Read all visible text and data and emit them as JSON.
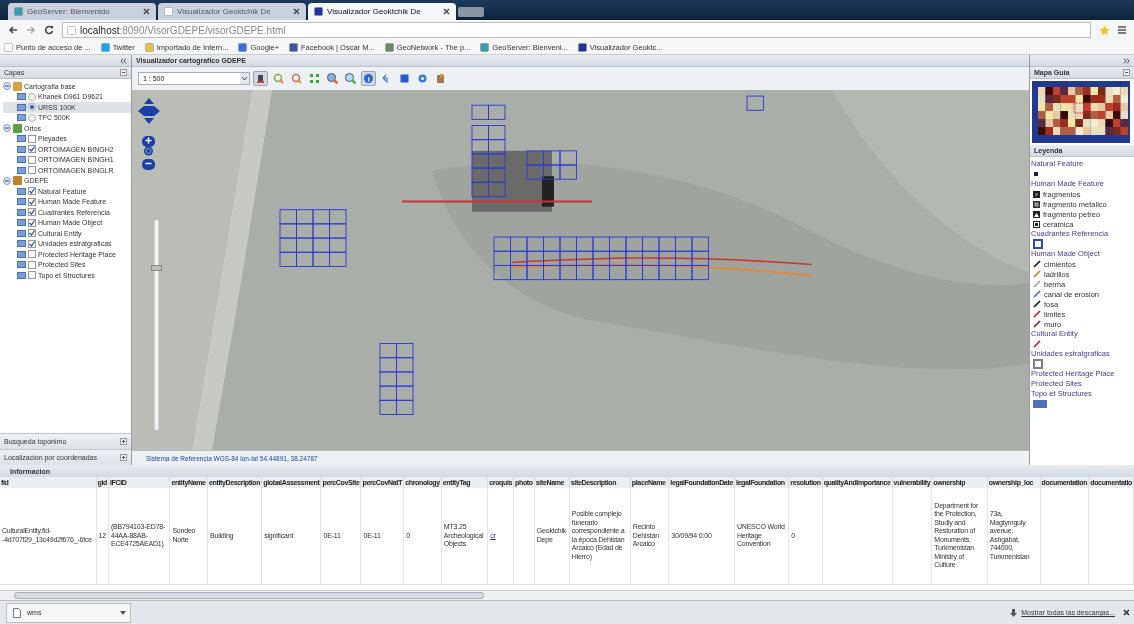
{
  "browser": {
    "tabs": [
      {
        "title": "GeoServer: Bienvenido",
        "kind": "geoserver",
        "selected": false
      },
      {
        "title": "Visualizador Geoktchik De",
        "kind": "page",
        "selected": false
      },
      {
        "title": "Visualizador Geoktchik De",
        "kind": "gdepe",
        "selected": true
      }
    ],
    "url": {
      "host": "localhost",
      "path": ":8090/VisorGDEPE/visorGDEPE.html"
    },
    "bookmarks": [
      {
        "label": "Punto de acceso de ...",
        "kind": "page"
      },
      {
        "label": "Twitter",
        "kind": "twitter"
      },
      {
        "label": "Importado de Intern...",
        "kind": "folder"
      },
      {
        "label": "Google+",
        "kind": "google"
      },
      {
        "label": "Facebook | Oscar M...",
        "kind": "facebook"
      },
      {
        "label": "GeoNetwork - The p...",
        "kind": "geonetwork"
      },
      {
        "label": "GeoServer: Bienveni...",
        "kind": "geoserver"
      },
      {
        "label": "Visualizador Geoktc...",
        "kind": "gdepe"
      }
    ]
  },
  "layers": {
    "title": "Capas",
    "tree": [
      {
        "label": "Cartografia base",
        "kind": "base",
        "expanded": true,
        "children": [
          {
            "label": "Khanek D961 D9621",
            "kind": "radio",
            "selected": false
          },
          {
            "label": "URSS 100K",
            "kind": "radio",
            "selected": true
          },
          {
            "label": "TPC 500K",
            "kind": "radio",
            "selected": false
          }
        ]
      },
      {
        "label": "Ortos",
        "kind": "imagery",
        "expanded": true,
        "children": [
          {
            "label": "Pleyades",
            "kind": "checkbox",
            "checked": false
          },
          {
            "label": "ORTOIMAGEN BINGH2",
            "kind": "checkbox",
            "checked": true
          },
          {
            "label": "ORTOIMAGEN BINGH1",
            "kind": "checkbox",
            "checked": false
          },
          {
            "label": "ORTOIMAGEN BINGLR",
            "kind": "checkbox",
            "checked": false
          }
        ]
      },
      {
        "label": "GDEPE",
        "kind": "data",
        "expanded": true,
        "children": [
          {
            "label": "Natural Feature",
            "kind": "checkbox",
            "checked": true
          },
          {
            "label": "Human Made Feature",
            "kind": "checkbox",
            "checked": true
          },
          {
            "label": "Cuadrantes Referencia",
            "kind": "checkbox",
            "checked": true
          },
          {
            "label": "Human Made Object",
            "kind": "checkbox",
            "checked": true
          },
          {
            "label": "Cultural Entity",
            "kind": "checkbox",
            "checked": true
          },
          {
            "label": "Unidades estratgraficas",
            "kind": "checkbox",
            "checked": true
          },
          {
            "label": "Protected Heritage Place",
            "kind": "checkbox",
            "checked": false
          },
          {
            "label": "Protected Sites",
            "kind": "checkbox",
            "checked": false
          },
          {
            "label": "Topo et Structures",
            "kind": "checkbox",
            "checked": false
          }
        ]
      }
    ],
    "bottom_panels": [
      "Busqueda toponimo",
      "Localizacion por coordenadas"
    ]
  },
  "map": {
    "title": "Visualizador cartografico GDEPE",
    "scale": "1 : 500",
    "tools": [
      {
        "kind": "pan",
        "selected": true
      },
      {
        "kind": "zoom-in",
        "selected": false
      },
      {
        "kind": "zoom-out",
        "selected": false
      },
      {
        "kind": "extent",
        "selected": false
      },
      {
        "kind": "zoom-box",
        "selected": false
      },
      {
        "kind": "zoom-box-out",
        "selected": false
      },
      {
        "kind": "info",
        "selected": true
      },
      {
        "kind": "back",
        "selected": false
      },
      {
        "kind": "full",
        "selected": false
      },
      {
        "kind": "help",
        "selected": false
      },
      {
        "kind": "print",
        "selected": false
      }
    ],
    "zoom": {
      "level": 0.78
    },
    "status": "Sistema de Referencia WGS-84 lon-lat 54.44891, 38.24787"
  },
  "overview": {
    "title": "Mapa Guía"
  },
  "legend": {
    "title": "Leyenda",
    "groups": [
      {
        "title": "Natural Feature",
        "items": [
          {
            "kind": "point"
          }
        ]
      },
      {
        "title": "Human Made Feature",
        "items": [
          {
            "kind": "solid",
            "label": "fragmentos"
          },
          {
            "kind": "dotted",
            "label": "fragmento metalico"
          },
          {
            "kind": "stone",
            "label": "fragmento petreo"
          },
          {
            "kind": "hollow",
            "label": "ceramica"
          }
        ]
      },
      {
        "title": "Cuadrantes Referencia",
        "items": [
          {
            "kind": "box",
            "color": "#2a4fb0"
          }
        ]
      },
      {
        "title": "Human Made Object",
        "items": [
          {
            "kind": "line",
            "label": "cimientos",
            "color": "#111111"
          },
          {
            "kind": "line",
            "label": "ladrillos",
            "color": "#d07a20"
          },
          {
            "kind": "line",
            "label": "berma",
            "color": "#b09a90"
          },
          {
            "kind": "line",
            "label": "canal de erosion",
            "color": "#5060d0"
          },
          {
            "kind": "line",
            "label": "fosa",
            "color": "#111111"
          },
          {
            "kind": "line",
            "label": "limites",
            "color": "#d01818"
          },
          {
            "kind": "line",
            "label": "muro",
            "color": "#7a2020"
          }
        ]
      },
      {
        "title": "Cultural Entity",
        "items": [
          {
            "kind": "line",
            "color": "#d01818"
          }
        ]
      },
      {
        "title": "Unidades estratgraficas",
        "items": [
          {
            "kind": "box",
            "color": "#808080"
          }
        ]
      },
      {
        "title": "Protected Heritage Place"
      },
      {
        "title": "Protected Sites"
      },
      {
        "title": "Topo et Structures",
        "items": [
          {
            "kind": "fill",
            "color": "#5070c0"
          }
        ]
      }
    ]
  },
  "info": {
    "title": "Informacion",
    "columns": [
      "fid",
      "gid",
      "IFCID",
      "entityName",
      "entityDescription",
      "globalAssessment",
      "percCovSite",
      "percCovNatT",
      "chronology",
      "entityTag",
      "croquis",
      "photo",
      "siteName",
      "siteDescription",
      "placeName",
      "legalFoundationDate",
      "legalFoundation",
      "resolution",
      "qualityAndImportance",
      "vulnerability",
      "ownership",
      "ownership_loc",
      "documentation",
      "documentatio"
    ],
    "rows": [
      [
        {
          "text": "CulturalEntity.fid--4d707f29_13c49d2f676_-6fce"
        },
        {
          "text": "12"
        },
        {
          "text": "(BB794103-ED78-44AA-88AB-ECE4725AEAD1)"
        },
        {
          "text": "Sondeo Norte"
        },
        {
          "text": "Building"
        },
        {
          "text": "significant"
        },
        {
          "text": "0E-11"
        },
        {
          "text": "0E-11"
        },
        {
          "text": "0"
        },
        {
          "text": "MT3.25 Archeological Objects"
        },
        {
          "text": "cr",
          "kind": "link"
        },
        {
          "text": ""
        },
        {
          "text": "Geoktchik Depe"
        },
        {
          "text": "Posible complejo funerario correspondiente a la época Dehistan Arcaico (Edad de Hierro)"
        },
        {
          "text": "Recinto Dehistán Arcaico"
        },
        {
          "text": "30/09/94 0:00"
        },
        {
          "text": "UNESCO World Heritage Convention"
        },
        {
          "text": "0"
        },
        {
          "text": ""
        },
        {
          "text": ""
        },
        {
          "text": "Department for the Protection, Studly and Restoration of Monuments, Turkmenistan Ministry of Culture"
        },
        {
          "text": "73a, Magtymguly avenue. Ashgabat, 744000, Turkmenistan"
        },
        {
          "text": ""
        },
        {
          "text": ""
        }
      ]
    ]
  },
  "downloads": {
    "file": "wms",
    "show_all": "Mostrar todas las descargas..."
  }
}
